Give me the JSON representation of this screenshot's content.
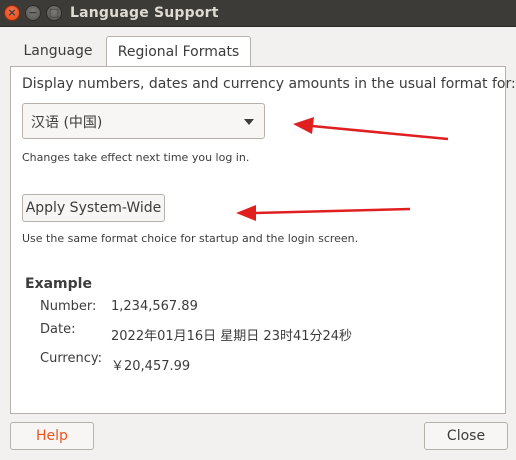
{
  "window": {
    "title": "Language Support",
    "controls": {
      "close": "×",
      "minimize": "−",
      "maximize": "□"
    }
  },
  "tabs": [
    {
      "label": "Language",
      "active": false
    },
    {
      "label": "Regional Formats",
      "active": true
    }
  ],
  "regional": {
    "prompt": "Display numbers, dates and currency amounts in the usual format for:",
    "format_select": {
      "selected": "汉语 (中国)"
    },
    "relogin_note": "Changes take effect next time you log in.",
    "apply_button": "Apply System-Wide",
    "apply_note": "Use the same format choice for startup and the login screen."
  },
  "example": {
    "title": "Example",
    "number_label": "Number:",
    "number_value": "1,234,567.89",
    "date_label": "Date:",
    "date_value": "2022年01月16日 星期日 23时41分24秒",
    "currency_label": "Currency:",
    "currency_value": "￥20,457.99"
  },
  "footer": {
    "help_button": "Help",
    "close_button": "Close"
  },
  "colors": {
    "accent": "#e95420",
    "titlebar": "#3c3b37",
    "annotation_arrow": "#e02020"
  }
}
